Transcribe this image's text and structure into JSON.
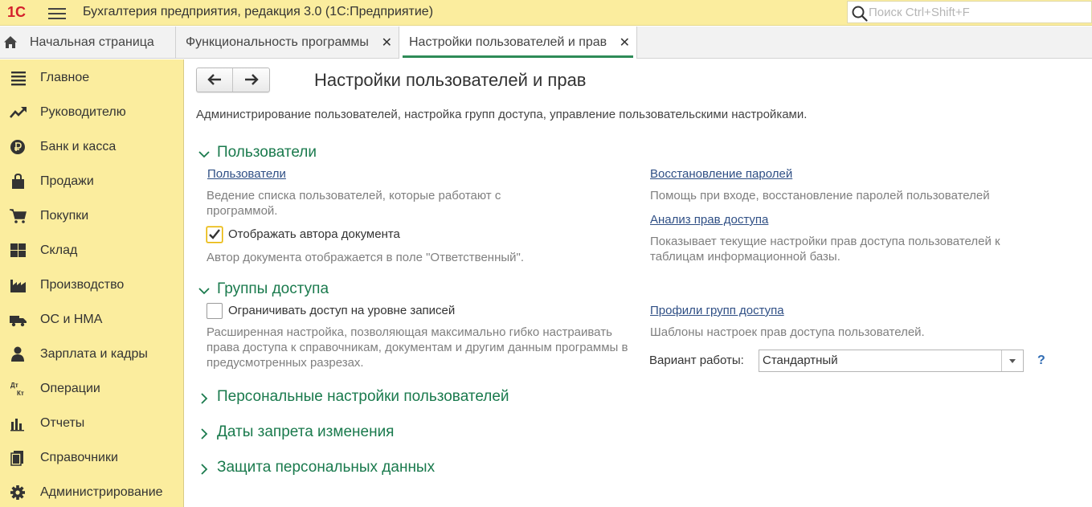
{
  "titlebar": {
    "logo": "1С",
    "app_title": "Бухгалтерия предприятия, редакция 3.0  (1С:Предприятие)",
    "search_placeholder": "Поиск Ctrl+Shift+F"
  },
  "tabs": [
    {
      "label": "Начальная страница",
      "icon": "home-icon"
    },
    {
      "label": "Функциональность программы",
      "closable": true
    },
    {
      "label": "Настройки пользователей и прав",
      "closable": true,
      "active": true
    }
  ],
  "tab_close": "✕",
  "sidebar": {
    "items": [
      {
        "label": "Главное",
        "icon": "list-icon"
      },
      {
        "label": "Руководителю",
        "icon": "trend-icon"
      },
      {
        "label": "Банк и касса",
        "icon": "ruble-icon"
      },
      {
        "label": "Продажи",
        "icon": "bag-icon"
      },
      {
        "label": "Покупки",
        "icon": "cart-icon"
      },
      {
        "label": "Склад",
        "icon": "warehouse-icon"
      },
      {
        "label": "Производство",
        "icon": "factory-icon"
      },
      {
        "label": "ОС и НМА",
        "icon": "truck-icon"
      },
      {
        "label": "Зарплата и кадры",
        "icon": "person-icon"
      },
      {
        "label": "Операции",
        "icon": "dt-kt-icon"
      },
      {
        "label": "Отчеты",
        "icon": "bar-chart-icon"
      },
      {
        "label": "Справочники",
        "icon": "books-icon"
      },
      {
        "label": "Администрирование",
        "icon": "gear-icon"
      }
    ],
    "dt": "Дт",
    "kt": "Кт"
  },
  "main": {
    "title": "Настройки пользователей и прав",
    "description": "Администрирование пользователей, настройка групп доступа, управление пользовательскими настройками.",
    "sections": {
      "users": {
        "title": "Пользователи",
        "expanded": true,
        "users_link": "Пользователи",
        "users_hint": "Ведение списка пользователей, которые работают с программой.",
        "show_author_label": "Отображать автора документа",
        "show_author_checked": true,
        "show_author_hint": "Автор документа отображается в поле \"Ответственный\".",
        "restore_link": "Восстановление паролей",
        "restore_hint": "Помощь при входе, восстановление паролей пользователей",
        "analysis_link": "Анализ прав доступа",
        "analysis_hint": "Показывает текущие настройки прав доступа пользователей к таблицам информационной базы."
      },
      "groups": {
        "title": "Группы доступа",
        "expanded": true,
        "restrict_label": "Ограничивать доступ на уровне записей",
        "restrict_checked": false,
        "restrict_hint": "Расширенная настройка, позволяющая максимально гибко настраивать права доступа к справочникам, документам и другим данным программы в предусмотренных разрезах.",
        "profiles_link": "Профили групп доступа",
        "profiles_hint": "Шаблоны настроек прав доступа пользователей.",
        "variant_label": "Вариант работы:",
        "variant_value": "Стандартный",
        "help": "?"
      },
      "personal": {
        "title": "Персональные настройки пользователей",
        "expanded": false
      },
      "dates": {
        "title": "Даты запрета изменения",
        "expanded": false
      },
      "protection": {
        "title": "Защита персональных данных",
        "expanded": false
      }
    }
  },
  "colors": {
    "titlebar_bg": "#fbed9e",
    "sidebar_bg": "#fbed9e",
    "section_title": "#1a7a4d",
    "link": "#2f4f85",
    "active_tab_underline": "#2e8b57",
    "logo_red": "#d4202c"
  }
}
